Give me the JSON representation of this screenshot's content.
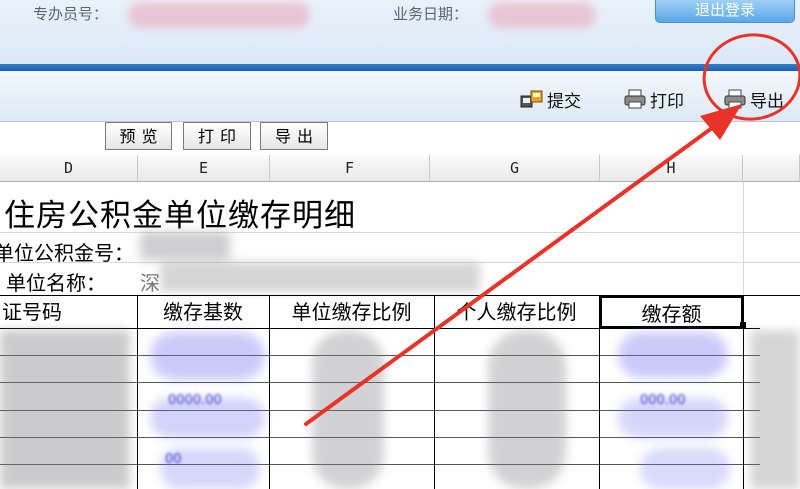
{
  "header": {
    "operator_label": "专办员号：",
    "business_date_label": "业务日期：",
    "logout_label": "退出登录"
  },
  "toolbar": {
    "submit_label": "提交",
    "print_label": "打印",
    "export_label": "导出"
  },
  "report_buttons": {
    "preview_label": "预览",
    "print_label": "打印",
    "export_label": "导出"
  },
  "sheet": {
    "columns": [
      "D",
      "E",
      "F",
      "G",
      "H"
    ],
    "title": "住房公积金单位缴存明细",
    "fund_no_label": "单位公积金号：",
    "unit_name_label": "单位名称：",
    "unit_name_partial": "深",
    "table_headers": [
      "证号码",
      "缴存基数",
      "单位缴存比例",
      "个人缴存比例",
      "缴存额"
    ]
  },
  "colors": {
    "accent_blue": "#1d5fa8",
    "annotation_red": "#e8332a"
  }
}
